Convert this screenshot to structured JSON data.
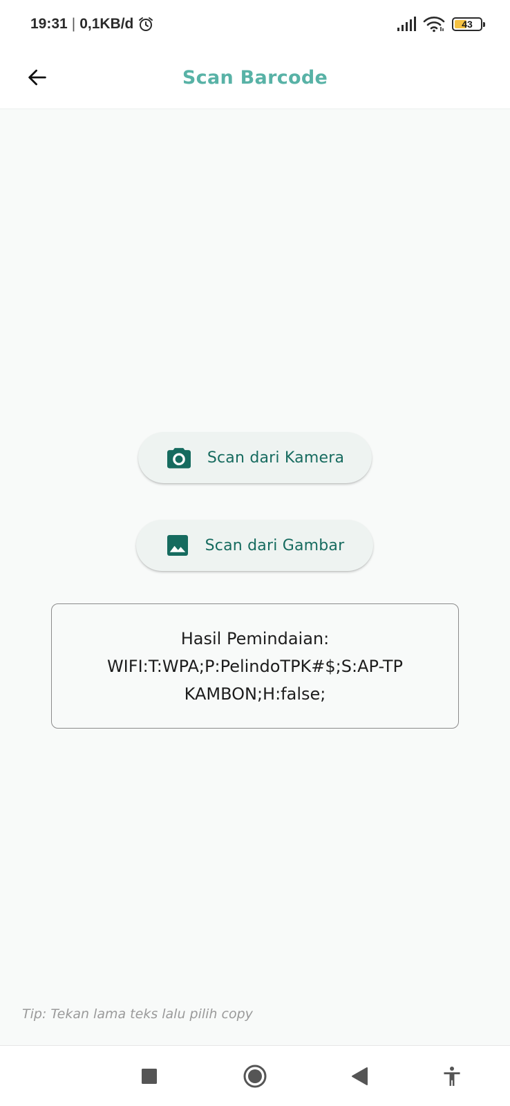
{
  "status_bar": {
    "time": "19:31",
    "separator": "|",
    "network_speed": "0,1KB/d",
    "battery_level": "43",
    "battery_fraction": 0.43,
    "icons": [
      "alarm-icon",
      "signal-icon",
      "wifi-icon",
      "battery-icon"
    ]
  },
  "app_bar": {
    "title": "Scan Barcode",
    "back_icon": "arrow-back-icon"
  },
  "buttons": {
    "scan_camera_label": "Scan dari Kamera",
    "scan_camera_icon": "camera-icon",
    "scan_image_label": "Scan dari Gambar",
    "scan_image_icon": "image-icon"
  },
  "result": {
    "label": "Hasil Pemindaian:",
    "value": "WIFI:T:WPA;P:PelindoTPK#$;S:AP-TPKAMBON;H:false;"
  },
  "tip": "Tip: Tekan lama teks lalu pilih copy",
  "nav_bar": {
    "icons": [
      "recents-square-icon",
      "home-circle-icon",
      "back-triangle-icon",
      "accessibility-icon"
    ]
  },
  "colors": {
    "accent": "#58b2a6",
    "button_text": "#166b5f",
    "button_bg": "#eef3f1",
    "background": "#f8faf9"
  }
}
